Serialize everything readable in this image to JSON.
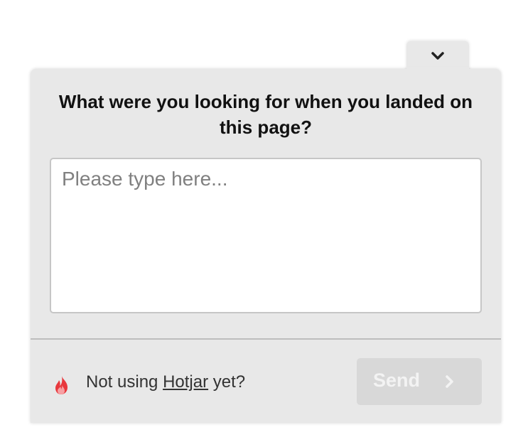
{
  "survey": {
    "question": "What were you looking for when you landed on this page?",
    "answer_placeholder": "Please type here...",
    "answer_value": "",
    "collapse_icon": "chevron-down-icon"
  },
  "footer": {
    "promo_prefix": "Not using",
    "promo_link": "Hotjar",
    "promo_suffix": "yet?",
    "brand_icon": "hotjar-flame-icon",
    "send_label": "Send",
    "send_icon": "chevron-right-icon"
  },
  "colors": {
    "panel_background": "#e8e8e8",
    "send_disabled_background": "#d8d8d8",
    "brand_red": "#e8383d"
  }
}
